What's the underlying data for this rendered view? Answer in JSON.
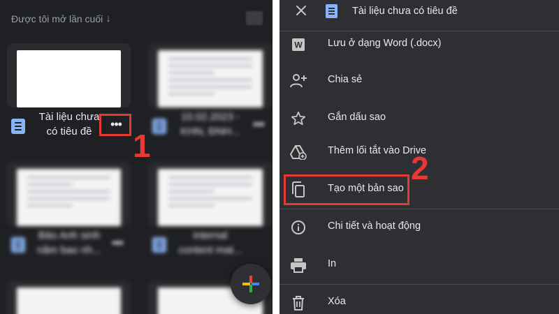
{
  "left_panel": {
    "sort_label": "Được tôi mở lần cuối",
    "sort_arrow": "↓",
    "cards": [
      {
        "title_line1": "Tài liệu chưa",
        "title_line2": "có tiêu đề",
        "more": "•••"
      },
      {
        "title_line1": "10.02.2023 -",
        "title_line2": "KHN, ĐNH...",
        "more": "•••"
      },
      {
        "title_line1": "Bảo Anh sinh",
        "title_line2": "năm bao nh...",
        "more": "•••"
      },
      {
        "title_line1": "internal",
        "title_line2": "content mat...",
        "more": "•••"
      }
    ],
    "step_marker": "1"
  },
  "menu": {
    "title": "Tài liệu chưa có tiêu đề",
    "items": [
      {
        "label": "Lưu ở dạng Word (.docx)"
      },
      {
        "label": "Chia sẻ"
      },
      {
        "label": "Gắn dấu sao"
      },
      {
        "label": "Thêm lối tắt vào Drive"
      },
      {
        "label": "Tạo một bản sao"
      },
      {
        "label": "Chi tiết và hoạt động"
      },
      {
        "label": "In"
      },
      {
        "label": "Xóa"
      }
    ],
    "step_marker": "2"
  },
  "icons": {
    "word": "W",
    "close": "close-icon",
    "share": "person-add-icon",
    "star": "star-icon",
    "shortcut": "drive-shortcut-icon",
    "copy": "copy-icon",
    "info": "info-icon",
    "print": "print-icon",
    "delete": "trash-icon",
    "fab": "google-plus-icon"
  },
  "colors": {
    "highlight": "#e53935",
    "docs_blue": "#8ab4f8",
    "dark_bg": "#1f2023",
    "menu_bg": "#2e2f32"
  }
}
